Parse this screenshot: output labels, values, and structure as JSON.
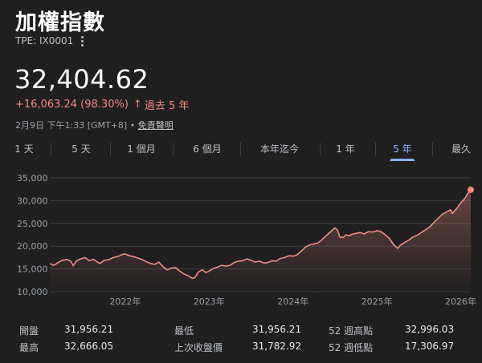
{
  "header": {
    "title": "加權指數",
    "ticker": "TPE: IX0001",
    "more_icon": "more-vert-icon"
  },
  "quote": {
    "price": "32,404.62",
    "change": "+16,063.24 (98.30%)",
    "change_arrow": "↑",
    "period": "過去 5 年",
    "timestamp": "2月9日 下午1:33 [GMT+8] • ",
    "disclaimer": "免責聲明",
    "positive_color": "#f28b82"
  },
  "tabs": [
    {
      "label": "1 天",
      "active": false
    },
    {
      "label": "5 天",
      "active": false
    },
    {
      "label": "1 個月",
      "active": false
    },
    {
      "label": "6 個月",
      "active": false
    },
    {
      "label": "本年迄今",
      "active": false
    },
    {
      "label": "1 年",
      "active": false
    },
    {
      "label": "5 年",
      "active": true
    },
    {
      "label": "最久",
      "active": false
    }
  ],
  "chart_data": {
    "type": "area",
    "y_ticks": [
      "35,000",
      "30,000",
      "25,000",
      "20,000",
      "15,000",
      "10,000"
    ],
    "x_ticks": [
      "2022年",
      "2023年",
      "2024年",
      "2025年",
      "2026年"
    ],
    "ylim": [
      10000,
      35000
    ],
    "xlim": [
      2021.1,
      2026.12
    ],
    "grid": true,
    "series": [
      {
        "color": "#f28b82",
        "points": [
          [
            2021.1,
            16200
          ],
          [
            2021.15,
            15800
          ],
          [
            2021.2,
            16400
          ],
          [
            2021.25,
            16900
          ],
          [
            2021.3,
            17100
          ],
          [
            2021.35,
            16700
          ],
          [
            2021.38,
            15700
          ],
          [
            2021.42,
            16800
          ],
          [
            2021.47,
            17200
          ],
          [
            2021.52,
            17500
          ],
          [
            2021.57,
            16800
          ],
          [
            2021.62,
            17100
          ],
          [
            2021.67,
            16500
          ],
          [
            2021.7,
            16200
          ],
          [
            2021.75,
            16900
          ],
          [
            2021.8,
            17000
          ],
          [
            2021.86,
            17500
          ],
          [
            2021.92,
            17800
          ],
          [
            2021.97,
            18200
          ],
          [
            2022.0,
            18300
          ],
          [
            2022.05,
            17900
          ],
          [
            2022.1,
            17700
          ],
          [
            2022.15,
            17400
          ],
          [
            2022.2,
            17100
          ],
          [
            2022.25,
            16600
          ],
          [
            2022.3,
            16200
          ],
          [
            2022.35,
            16000
          ],
          [
            2022.4,
            16500
          ],
          [
            2022.45,
            15500
          ],
          [
            2022.5,
            14800
          ],
          [
            2022.55,
            15200
          ],
          [
            2022.6,
            15300
          ],
          [
            2022.65,
            14500
          ],
          [
            2022.7,
            13900
          ],
          [
            2022.75,
            13500
          ],
          [
            2022.8,
            12900
          ],
          [
            2022.83,
            13100
          ],
          [
            2022.87,
            14300
          ],
          [
            2022.92,
            14800
          ],
          [
            2022.96,
            14200
          ],
          [
            2023.0,
            14500
          ],
          [
            2023.05,
            15100
          ],
          [
            2023.1,
            15400
          ],
          [
            2023.15,
            15800
          ],
          [
            2023.2,
            15600
          ],
          [
            2023.25,
            15800
          ],
          [
            2023.3,
            16400
          ],
          [
            2023.35,
            16700
          ],
          [
            2023.4,
            16800
          ],
          [
            2023.45,
            17200
          ],
          [
            2023.5,
            16900
          ],
          [
            2023.55,
            16500
          ],
          [
            2023.6,
            16700
          ],
          [
            2023.65,
            16300
          ],
          [
            2023.7,
            16400
          ],
          [
            2023.75,
            16800
          ],
          [
            2023.8,
            16700
          ],
          [
            2023.85,
            17300
          ],
          [
            2023.9,
            17500
          ],
          [
            2023.95,
            17900
          ],
          [
            2024.0,
            17800
          ],
          [
            2024.05,
            18100
          ],
          [
            2024.1,
            18900
          ],
          [
            2024.15,
            19800
          ],
          [
            2024.2,
            20300
          ],
          [
            2024.25,
            20500
          ],
          [
            2024.3,
            20700
          ],
          [
            2024.35,
            21500
          ],
          [
            2024.4,
            22400
          ],
          [
            2024.45,
            23200
          ],
          [
            2024.5,
            24000
          ],
          [
            2024.53,
            23600
          ],
          [
            2024.56,
            22000
          ],
          [
            2024.6,
            21900
          ],
          [
            2024.63,
            22500
          ],
          [
            2024.67,
            22300
          ],
          [
            2024.7,
            22600
          ],
          [
            2024.75,
            22800
          ],
          [
            2024.8,
            23000
          ],
          [
            2024.85,
            22700
          ],
          [
            2024.9,
            23200
          ],
          [
            2024.95,
            23100
          ],
          [
            2025.0,
            23400
          ],
          [
            2025.05,
            23200
          ],
          [
            2025.1,
            22500
          ],
          [
            2025.15,
            21700
          ],
          [
            2025.2,
            20300
          ],
          [
            2025.25,
            19500
          ],
          [
            2025.28,
            20200
          ],
          [
            2025.33,
            20800
          ],
          [
            2025.38,
            21300
          ],
          [
            2025.43,
            22000
          ],
          [
            2025.48,
            22400
          ],
          [
            2025.53,
            23000
          ],
          [
            2025.58,
            23600
          ],
          [
            2025.63,
            24200
          ],
          [
            2025.68,
            25200
          ],
          [
            2025.73,
            26100
          ],
          [
            2025.78,
            27000
          ],
          [
            2025.83,
            27500
          ],
          [
            2025.88,
            28000
          ],
          [
            2025.9,
            27200
          ],
          [
            2025.95,
            28200
          ],
          [
            2026.0,
            29500
          ],
          [
            2026.05,
            30500
          ],
          [
            2026.08,
            31500
          ],
          [
            2026.1,
            31900
          ],
          [
            2026.12,
            32404.62
          ]
        ]
      }
    ]
  },
  "stats": [
    {
      "label": "開盤",
      "value": "31,956.21"
    },
    {
      "label": "最低",
      "value": "31,956.21"
    },
    {
      "label": "52 週高點",
      "value": "32,996.03"
    },
    {
      "label": "最高",
      "value": "32,666.05"
    },
    {
      "label": "上次收盤價",
      "value": "31,782.92"
    },
    {
      "label": "52 週低點",
      "value": "17,306.97"
    }
  ]
}
